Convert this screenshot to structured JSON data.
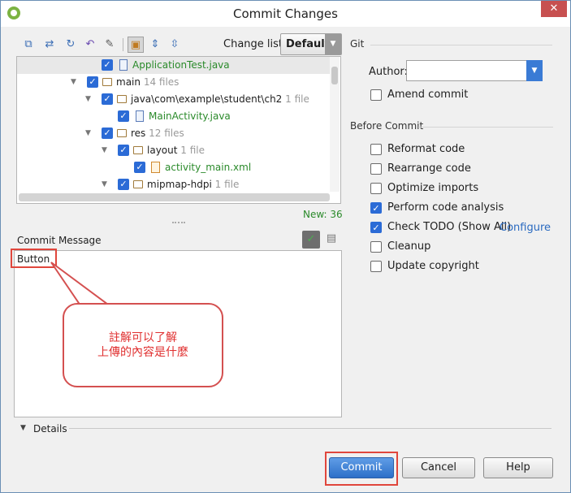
{
  "window": {
    "title": "Commit Changes",
    "close_label": "✕"
  },
  "toolbar": {
    "buttons": [
      "diff-icon",
      "move-icon",
      "refresh-icon",
      "revert-icon",
      "edit-icon",
      "group-by-directory-icon",
      "expand-all-icon",
      "collapse-all-icon"
    ],
    "changelist_label": "Change list:",
    "changelist_value": "Default"
  },
  "tree": {
    "rows": [
      {
        "label": "ApplicationTest.java",
        "count": "",
        "kind": "java",
        "checked": true
      },
      {
        "label": "main",
        "count": "14 files",
        "kind": "folder",
        "checked": true
      },
      {
        "label": "java\\com\\example\\student\\ch2",
        "count": "1 file",
        "kind": "folder",
        "checked": true
      },
      {
        "label": "MainActivity.java",
        "count": "",
        "kind": "java",
        "checked": true
      },
      {
        "label": "res",
        "count": "12 files",
        "kind": "folder",
        "checked": true
      },
      {
        "label": "layout",
        "count": "1 file",
        "kind": "folder",
        "checked": true
      },
      {
        "label": "activity_main.xml",
        "count": "",
        "kind": "xml",
        "checked": true
      },
      {
        "label": "mipmap-hdpi",
        "count": "1 file",
        "kind": "folder",
        "checked": true
      }
    ],
    "new_count": "New: 36"
  },
  "commit_message": {
    "label": "Commit Message",
    "value": "Button",
    "annotation_line1": "註解可以了解",
    "annotation_line2": "上傳的內容是什麼"
  },
  "details": {
    "label": "Details"
  },
  "git": {
    "section_label": "Git",
    "author_label": "Author:",
    "author_value": "",
    "amend_label": "Amend commit",
    "amend_checked": false
  },
  "before_commit": {
    "section_label": "Before Commit",
    "options": [
      {
        "label": "Reformat code",
        "checked": false
      },
      {
        "label": "Rearrange code",
        "checked": false
      },
      {
        "label": "Optimize imports",
        "checked": false
      },
      {
        "label": "Perform code analysis",
        "checked": true
      },
      {
        "label": "Check TODO (Show All)",
        "checked": true
      },
      {
        "label": "Cleanup",
        "checked": false
      },
      {
        "label": "Update copyright",
        "checked": false
      }
    ],
    "configure_label": "Configure"
  },
  "buttons": {
    "commit": "Commit",
    "cancel": "Cancel",
    "help": "Help"
  },
  "colors": {
    "accent": "#2b6bd6",
    "highlight": "#e0463c",
    "new_files": "#2a8a2a"
  }
}
